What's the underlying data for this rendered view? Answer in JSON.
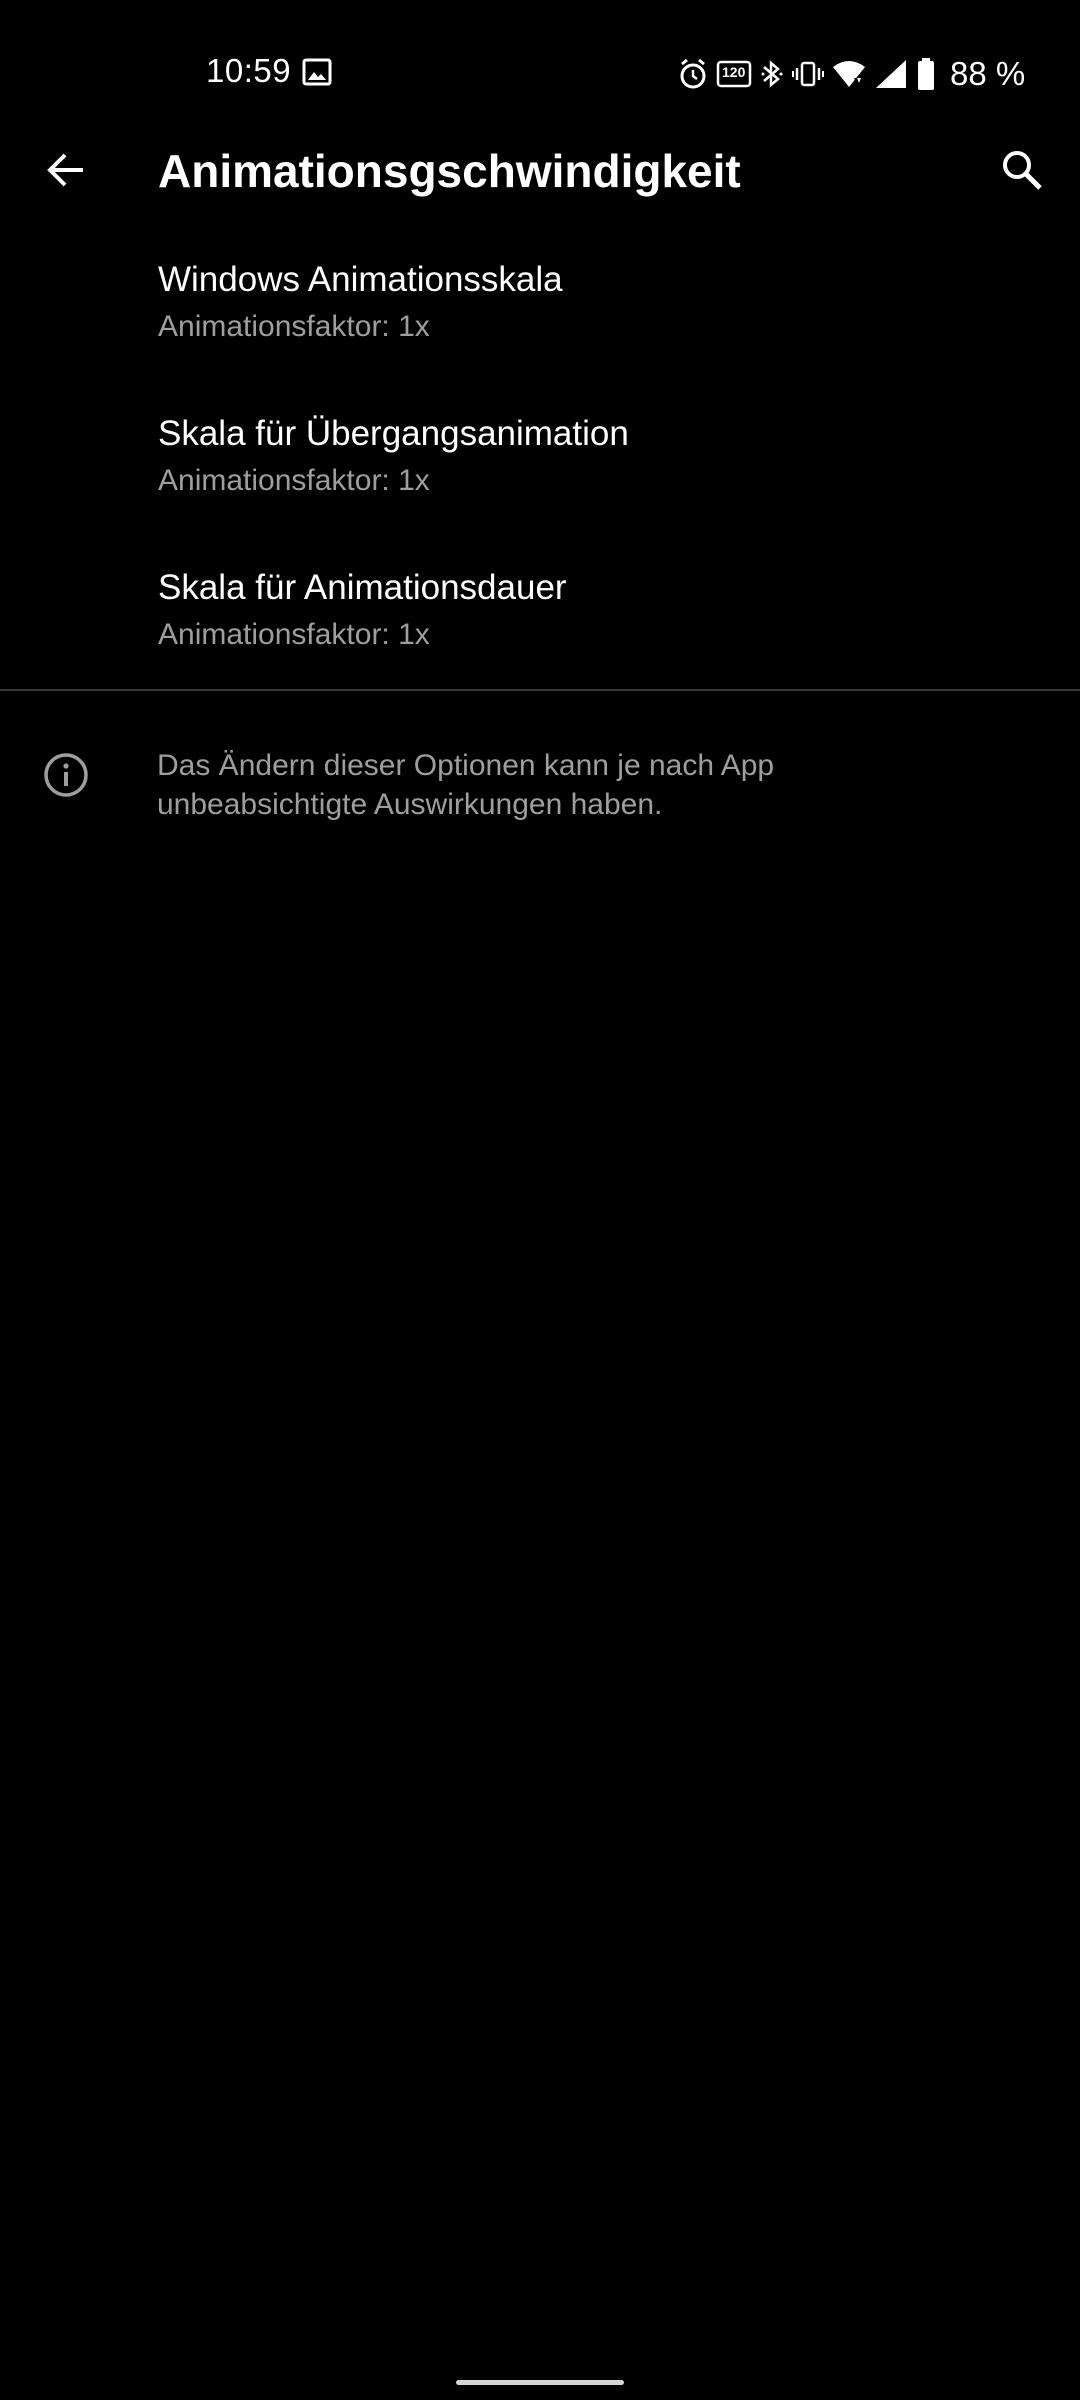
{
  "status_bar": {
    "time": "10:59",
    "battery": "88 %",
    "icons": [
      "gallery-icon",
      "alarm-icon",
      "refresh-rate-120hz-icon",
      "bluetooth-icon",
      "vibrate-icon",
      "wifi-icon",
      "signal-icon",
      "battery-icon"
    ],
    "refresh_rate_label": "120"
  },
  "app_bar": {
    "title": "Animationsgschwindigkeit"
  },
  "settings": {
    "items": [
      {
        "title": "Windows Animationsskala",
        "summary": "Animationsfaktor: 1x"
      },
      {
        "title": "Skala für Übergangsanimation",
        "summary": "Animationsfaktor: 1x"
      },
      {
        "title": "Skala für Animationsdauer",
        "summary": "Animationsfaktor: 1x"
      }
    ]
  },
  "footer": {
    "info_text": "Das Ändern dieser Optionen kann je nach App unbeabsichtigte Auswirkungen haben."
  },
  "colors": {
    "background": "#000000",
    "primary_text": "#ffffff",
    "secondary_text": "#9e9e9e",
    "divider": "#3a3a3a"
  }
}
